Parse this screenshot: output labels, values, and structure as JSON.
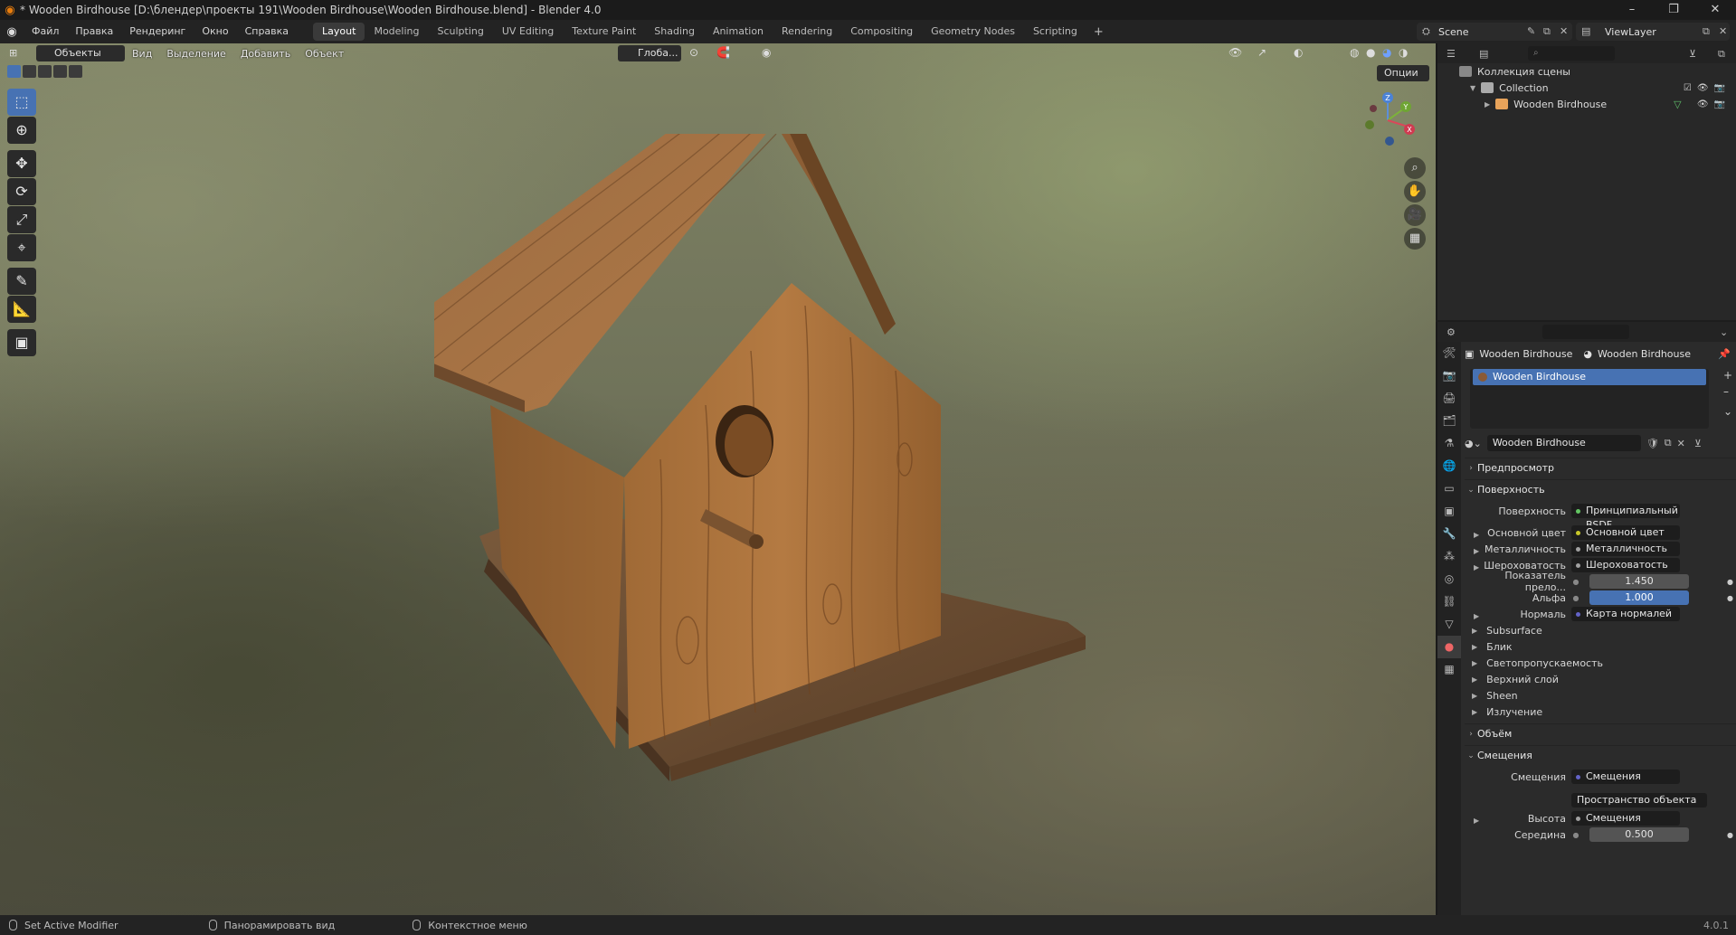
{
  "window": {
    "title": "* Wooden Birdhouse [D:\\блендер\\проекты 191\\Wooden Birdhouse\\Wooden Birdhouse.blend] - Blender 4.0"
  },
  "menus": [
    "Файл",
    "Правка",
    "Рендеринг",
    "Окно",
    "Справка"
  ],
  "workspaces": [
    "Layout",
    "Modeling",
    "Sculpting",
    "UV Editing",
    "Texture Paint",
    "Shading",
    "Animation",
    "Rendering",
    "Compositing",
    "Geometry Nodes",
    "Scripting"
  ],
  "active_workspace": "Layout",
  "scene": "Scene",
  "view_layer": "ViewLayer",
  "viewport": {
    "mode": "Объекты",
    "menus": [
      "Вид",
      "Выделение",
      "Добавить",
      "Объект"
    ],
    "orientation": "Глоба...",
    "options": "Опции",
    "gizmo": {
      "x": "X",
      "y": "Y",
      "z": "Z"
    }
  },
  "outliner": {
    "scene_collection": "Коллекция сцены",
    "collection": "Collection",
    "object": "Wooden Birdhouse"
  },
  "properties": {
    "breadcrumb_object": "Wooden Birdhouse",
    "breadcrumb_material": "Wooden Birdhouse",
    "slot": "Wooden Birdhouse",
    "material_name": "Wooden Birdhouse",
    "sections": {
      "preview": "Предпросмотр",
      "surface": "Поверхность",
      "volume": "Объём",
      "displacement": "Смещения"
    },
    "surface_rows": [
      {
        "label": "Поверхность",
        "value": "Принципиальный BSDF"
      },
      {
        "label": "Основной цвет",
        "value": "Основной цвет"
      },
      {
        "label": "Металличность",
        "value": "Металличность"
      },
      {
        "label": "Шероховатость",
        "value": "Шероховатость"
      }
    ],
    "ior": {
      "label": "Показатель прело...",
      "value": "1.450"
    },
    "alpha": {
      "label": "Альфа",
      "value": "1.000"
    },
    "normal": {
      "label": "Нормаль",
      "value": "Карта нормалей"
    },
    "subpanels": [
      "Subsurface",
      "Блик",
      "Светопропускаемость",
      "Верхний слой",
      "Sheen",
      "Излучение"
    ],
    "displacement_rows": {
      "label": "Смещения",
      "value": "Смещения",
      "space": "Пространство объекта",
      "height_label": "Высота",
      "height_value": "Смещения",
      "mid_label": "Середина",
      "mid_value": "0.500"
    }
  },
  "status": {
    "left": "Set Active Modifier",
    "middle": "Панорамировать вид",
    "right": "Контекстное меню",
    "version": "4.0.1"
  }
}
